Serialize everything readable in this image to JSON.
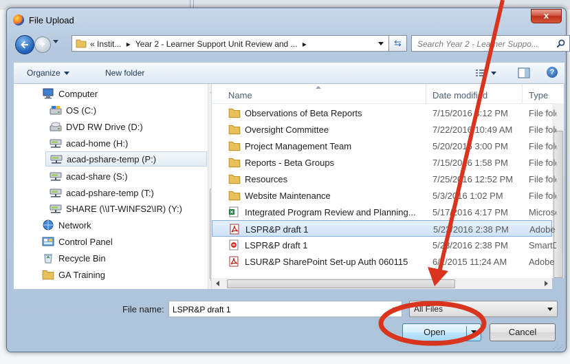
{
  "window": {
    "title": "File Upload",
    "close_label": "x"
  },
  "address_bar": {
    "breadcrumb_prefix": "«",
    "segments": [
      "Instit...",
      "Year 2 - Learner Support Unit Review and ..."
    ],
    "separator": "▸",
    "search_placeholder": "Search Year 2 - Learner Suppo..."
  },
  "command_bar": {
    "organize_label": "Organize",
    "new_folder_label": "New folder",
    "help_label": "?"
  },
  "nav_pane": {
    "items": [
      {
        "label": "Computer",
        "icon": "computer-icon",
        "indent": 1
      },
      {
        "label": "OS (C:)",
        "icon": "hard-drive-icon",
        "indent": 2
      },
      {
        "label": "DVD RW Drive (D:)",
        "icon": "dvd-drive-icon",
        "indent": 2
      },
      {
        "label": "acad-home (H:)",
        "icon": "network-drive-icon",
        "indent": 2
      },
      {
        "label": "acad-pshare-temp (P:)",
        "icon": "network-drive-icon",
        "indent": 2,
        "selected": true
      },
      {
        "label": "acad-share (S:)",
        "icon": "network-drive-icon",
        "indent": 2
      },
      {
        "label": "acad-pshare-temp (T:)",
        "icon": "network-drive-icon",
        "indent": 2
      },
      {
        "label": "SHARE (\\\\IT-WINFS2\\IR) (Y:)",
        "icon": "network-drive-icon",
        "indent": 2
      },
      {
        "label": "Network",
        "icon": "network-icon",
        "indent": 1
      },
      {
        "label": "Control Panel",
        "icon": "control-panel-icon",
        "indent": 1
      },
      {
        "label": "Recycle Bin",
        "icon": "recycle-bin-icon",
        "indent": 1
      },
      {
        "label": "GA Training",
        "icon": "folder-icon",
        "indent": 1
      }
    ]
  },
  "file_list": {
    "columns": [
      "Name",
      "Date modified",
      "Type"
    ],
    "rows": [
      {
        "name": "Observations of Beta Reports",
        "date": "7/15/2016 3:12 PM",
        "type": "File folder",
        "icon": "folder-icon"
      },
      {
        "name": "Oversight Committee",
        "date": "7/22/2016 10:49 AM",
        "type": "File folder",
        "icon": "folder-icon"
      },
      {
        "name": "Project Management Team",
        "date": "5/20/2016 3:00 PM",
        "type": "File folder",
        "icon": "folder-icon"
      },
      {
        "name": "Reports - Beta Groups",
        "date": "7/15/2016 1:58 PM",
        "type": "File folder",
        "icon": "folder-icon"
      },
      {
        "name": "Resources",
        "date": "7/25/2016 12:52 PM",
        "type": "File folder",
        "icon": "folder-icon"
      },
      {
        "name": "Website Maintenance",
        "date": "5/3/2016 1:02 PM",
        "type": "File folder",
        "icon": "folder-icon"
      },
      {
        "name": "Integrated Program Review and Planning...",
        "date": "5/17/2016 4:17 PM",
        "type": "Microsoft",
        "icon": "excel-icon"
      },
      {
        "name": "LSPR&P draft 1",
        "date": "5/23/2016 2:38 PM",
        "type": "Adobe",
        "icon": "pdf-icon",
        "selected": true
      },
      {
        "name": "LSPR&P draft 1",
        "date": "5/23/2016 2:38 PM",
        "type": "SmartD",
        "icon": "smartdoc-icon"
      },
      {
        "name": "LSUR&P SharePoint Set-up Auth 060115",
        "date": "6/1/2015 11:24 AM",
        "type": "Adobe",
        "icon": "pdf-icon"
      }
    ]
  },
  "footer": {
    "file_name_label": "File name:",
    "file_name_value": "LSPR&P draft 1",
    "filter_value": "All Files",
    "open_label": "Open",
    "cancel_label": "Cancel"
  },
  "annotation": {
    "arrow_color": "#d8341e",
    "circle_color": "#d8341e"
  }
}
